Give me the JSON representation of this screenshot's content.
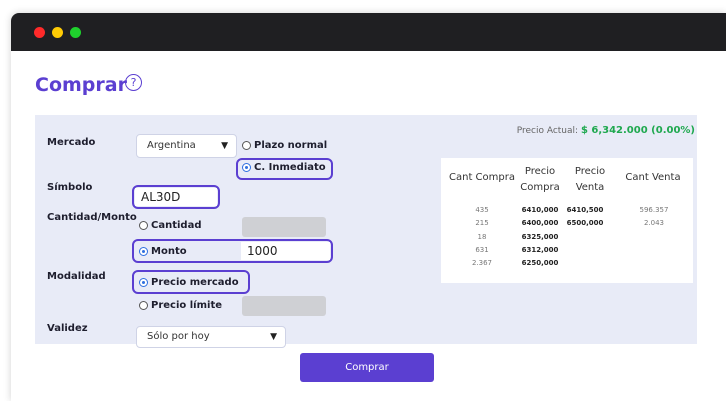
{
  "page": {
    "title": "Comprar",
    "help_icon": "?"
  },
  "form": {
    "labels": {
      "mercado": "Mercado",
      "simbolo": "Símbolo",
      "cantidad_monto": "Cantidad/Monto",
      "modalidad": "Modalidad",
      "validez": "Validez"
    },
    "mercado_select": "Argentina",
    "plazo_normal": "Plazo normal",
    "c_inmediato": "C. Inmediato",
    "simbolo_value": "AL30D",
    "cantidad": "Cantidad",
    "monto": "Monto",
    "monto_value": "1000",
    "precio_mercado": "Precio mercado",
    "precio_limite": "Precio límite",
    "validez_select": "Sólo por hoy",
    "submit": "Comprar"
  },
  "price": {
    "label": "Precio Actual:",
    "value": "$ 6,342.000 (0.00%)"
  },
  "order_book": {
    "headers": [
      "Cant Compra",
      "Precio Compra",
      "Precio Venta",
      "Cant Venta"
    ],
    "rows": [
      [
        "435",
        "6410,000",
        "6410,500",
        "596.357"
      ],
      [
        "215",
        "6400,000",
        "6500,000",
        "2.043"
      ],
      [
        "18",
        "6325,000",
        "",
        ""
      ],
      [
        "631",
        "6312,000",
        "",
        ""
      ],
      [
        "2.367",
        "6250,000",
        "",
        ""
      ]
    ]
  },
  "colors": {
    "accent": "#5b3fd1",
    "price_up": "#1fa84f",
    "panel": "#e8ebf7"
  },
  "icons": {
    "selected": "radio-checked-icon",
    "unselected": "radio-unchecked-icon",
    "dropdown": "chevron-down-icon"
  }
}
